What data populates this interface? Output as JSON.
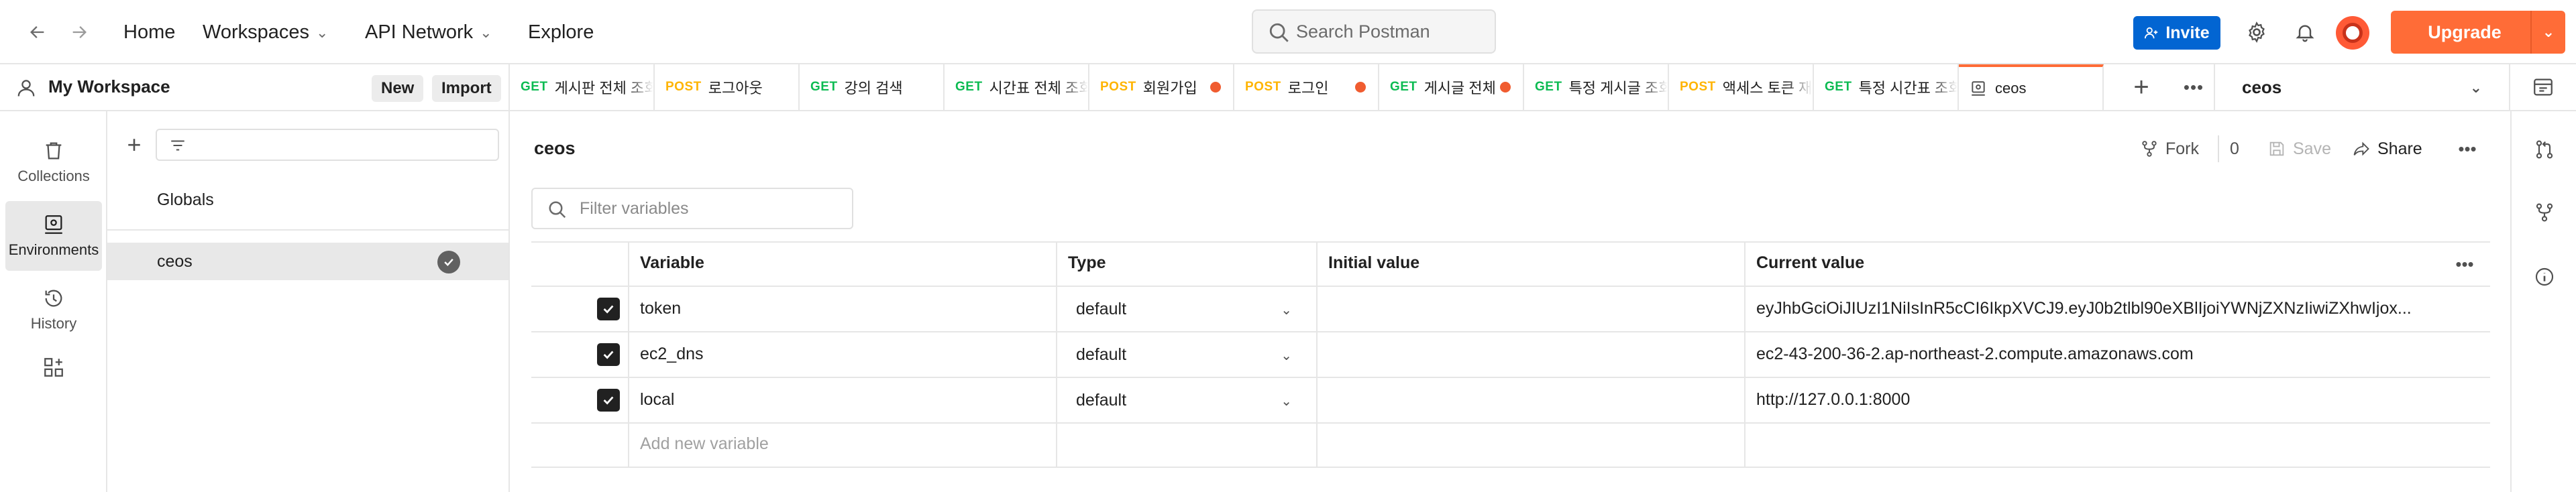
{
  "header": {
    "nav": [
      {
        "label": "Home"
      },
      {
        "label": "Workspaces"
      },
      {
        "label": "API Network"
      },
      {
        "label": "Explore"
      }
    ],
    "search_placeholder": "Search Postman",
    "invite_label": "Invite",
    "upgrade_label": "Upgrade",
    "icons": [
      "back-arrow-icon",
      "forward-arrow-icon",
      "search-icon",
      "settings-gear-icon",
      "bell-icon",
      "chevron-down-icon"
    ]
  },
  "workspace": {
    "name": "My Workspace",
    "new_label": "New",
    "import_label": "Import"
  },
  "rail": {
    "items": [
      {
        "label": "Collections",
        "icon": "trash-can-collection-icon"
      },
      {
        "label": "Environments",
        "icon": "environment-icon",
        "active": true
      },
      {
        "label": "History",
        "icon": "history-clock-icon"
      }
    ]
  },
  "environments": {
    "items": [
      {
        "label": "Globals"
      },
      {
        "label": "ceos",
        "active": true
      }
    ]
  },
  "tabs": [
    {
      "method": "GET",
      "title": "게시판 전체 조회"
    },
    {
      "method": "POST",
      "title": "로그아웃"
    },
    {
      "method": "GET",
      "title": "강의 검색"
    },
    {
      "method": "GET",
      "title": "시간표 전체 조회"
    },
    {
      "method": "POST",
      "title": "회원가입",
      "unsaved": true
    },
    {
      "method": "POST",
      "title": "로그인",
      "unsaved": true
    },
    {
      "method": "GET",
      "title": "게시글 전체",
      "unsaved": true
    },
    {
      "method": "GET",
      "title": "특정 게시글 조회"
    },
    {
      "method": "POST",
      "title": "액세스 토큰 재발급"
    },
    {
      "method": "GET",
      "title": "특정 시간표 조회"
    },
    {
      "title": "ceos",
      "active": true
    }
  ],
  "env_selector": {
    "value": "ceos"
  },
  "main": {
    "title": "ceos",
    "fork_label": "Fork",
    "fork_count": "0",
    "save_label": "Save",
    "share_label": "Share",
    "filter_placeholder": "Filter variables",
    "columns": [
      "Variable",
      "Type",
      "Initial value",
      "Current value"
    ],
    "rows": [
      {
        "checked": true,
        "variable": "token",
        "type": "default",
        "initial": "",
        "current": "eyJhbGciOiJIUzI1NiIsInR5cCI6IkpXVCJ9.eyJ0b2tlbl90eXBlIjoiYWNjZXNzIiwiZXhwIjox..."
      },
      {
        "checked": true,
        "variable": "ec2_dns",
        "type": "default",
        "initial": "",
        "current": "ec2-43-200-36-2.ap-northeast-2.compute.amazonaws.com"
      },
      {
        "checked": true,
        "variable": "local",
        "type": "default",
        "initial": "",
        "current": "http://127.0.0.1:8000"
      }
    ],
    "add_placeholder": "Add new variable"
  },
  "colors": {
    "accent": "#ff6c37",
    "invite_blue": "#0265d2",
    "get_green": "#0cbb52",
    "post_yellow": "#ffb400",
    "unsaved_dot": "#f05c30"
  }
}
